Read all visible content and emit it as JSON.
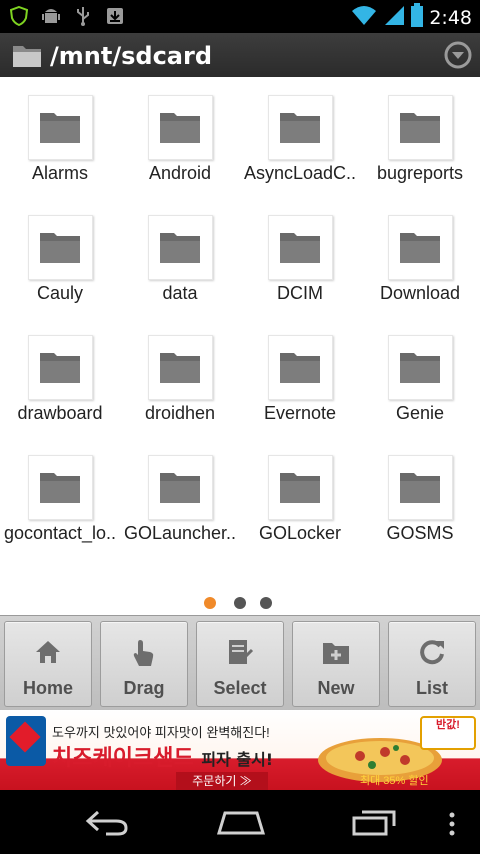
{
  "status_bar": {
    "time": "2:48",
    "left_icons": [
      "shield-icon",
      "android-debug-icon",
      "usb-icon",
      "download-icon"
    ],
    "right_icons": [
      "wifi-icon",
      "signal-icon",
      "battery-icon"
    ]
  },
  "title_bar": {
    "path": "/mnt/sdcard",
    "folder_icon": "folder-icon",
    "menu_icon": "chevron-down-circle-icon"
  },
  "folders": [
    {
      "name": "Alarms"
    },
    {
      "name": "Android"
    },
    {
      "name": "AsyncLoadC.."
    },
    {
      "name": "bugreports"
    },
    {
      "name": "Cauly"
    },
    {
      "name": "data"
    },
    {
      "name": "DCIM"
    },
    {
      "name": "Download"
    },
    {
      "name": "drawboard"
    },
    {
      "name": "droidhen"
    },
    {
      "name": "Evernote"
    },
    {
      "name": "Genie"
    },
    {
      "name": "gocontact_lo.."
    },
    {
      "name": "GOLauncher.."
    },
    {
      "name": "GOLocker"
    },
    {
      "name": "GOSMS"
    }
  ],
  "pager": {
    "pages": 3,
    "current": 1,
    "active_color": "#f08a2a",
    "inactive_color": "#555555"
  },
  "toolbar": {
    "buttons": [
      {
        "label": "Home",
        "icon": "home-icon"
      },
      {
        "label": "Drag",
        "icon": "hand-pointer-icon"
      },
      {
        "label": "Select",
        "icon": "checklist-icon"
      },
      {
        "label": "New",
        "icon": "new-folder-icon"
      },
      {
        "label": "List",
        "icon": "refresh-icon"
      }
    ]
  },
  "ad": {
    "top_text": "도우까지 맛있어야 피자맛이 완벽해진다!",
    "main_text": "치즈케이크샌드",
    "main_sub": "피자 출시!",
    "button_text": "주문하기 ≫",
    "badge_text": "반값!",
    "sale_text": "최대 35% 할인"
  },
  "nav_bar": {
    "icons": [
      "back-icon",
      "home-nav-icon",
      "recent-apps-icon",
      "overflow-menu-icon"
    ]
  },
  "colors": {
    "title_bg": "#333333",
    "toolbar_bg": "#cfcfcf",
    "folder_gray": "#7a7a7a"
  }
}
